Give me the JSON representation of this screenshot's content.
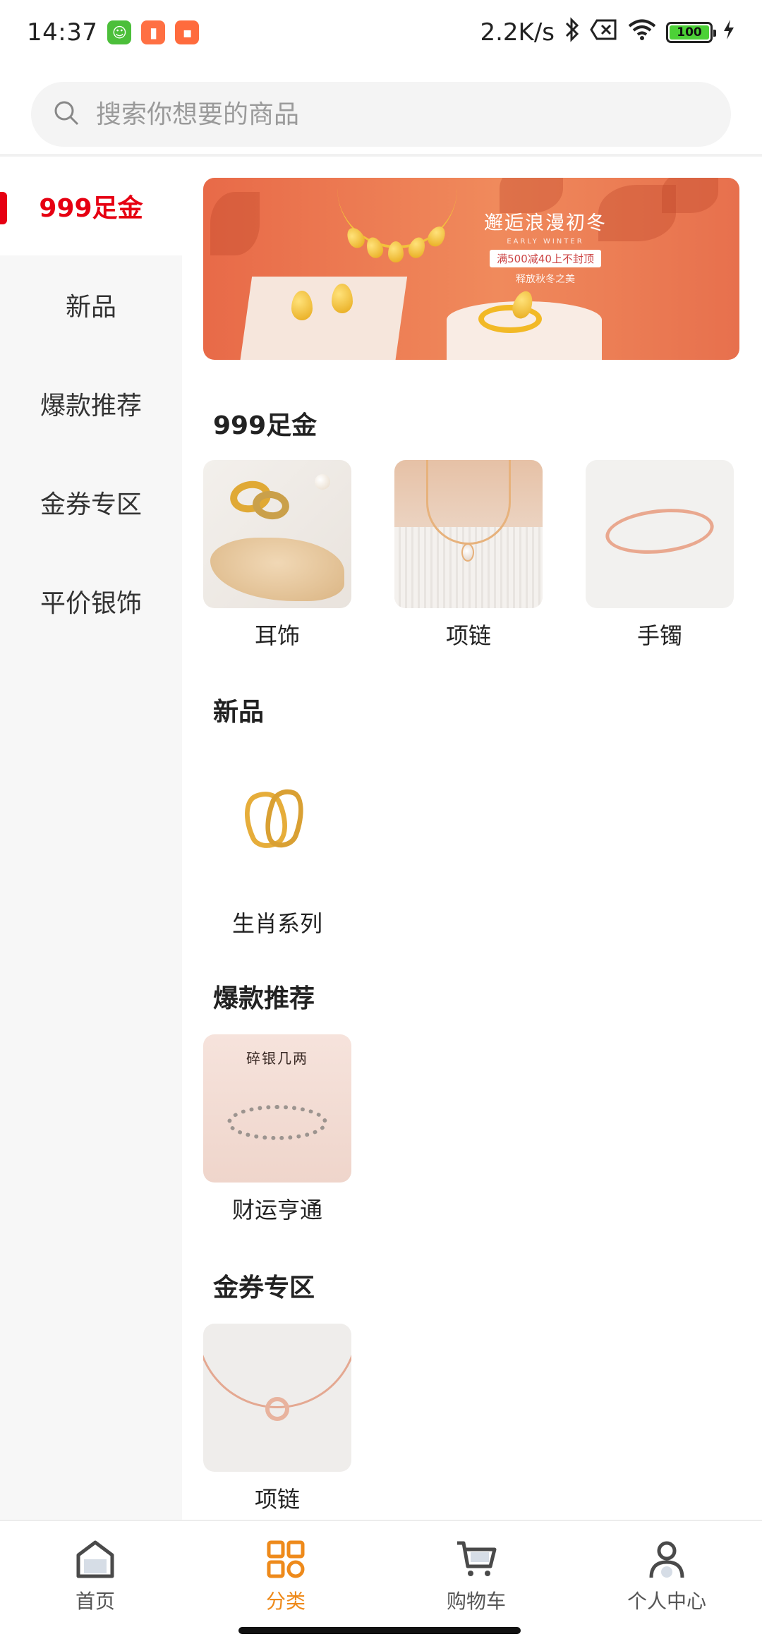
{
  "status_bar": {
    "time": "14:37",
    "net_speed": "2.2K/s",
    "battery": "100"
  },
  "search": {
    "placeholder": "搜索你想要的商品"
  },
  "sidebar": {
    "items": [
      {
        "label": "999足金",
        "active": true
      },
      {
        "label": "新品",
        "active": false
      },
      {
        "label": "爆款推荐",
        "active": false
      },
      {
        "label": "金券专区",
        "active": false
      },
      {
        "label": "平价银饰",
        "active": false
      }
    ]
  },
  "banner": {
    "title": "邂逅浪漫初冬",
    "subtitle": "EARLY WINTER",
    "promo": "满500减40上不封顶",
    "tag": "释放秋冬之美"
  },
  "sections": [
    {
      "title": "999足金",
      "products": [
        {
          "label": "耳饰",
          "icon": "gold-rings-image"
        },
        {
          "label": "项链",
          "icon": "pendant-necklace-image"
        },
        {
          "label": "手镯",
          "icon": "rose-gold-bangle-image"
        }
      ]
    },
    {
      "title": "新品",
      "products": [
        {
          "label": "生肖系列",
          "icon": "gold-twist-ring-image"
        }
      ]
    },
    {
      "title": "爆款推荐",
      "products": [
        {
          "label": "财运亨通",
          "icon": "silver-bracelet-image"
        }
      ]
    },
    {
      "title": "金券专区",
      "products": [
        {
          "label": "项链",
          "icon": "rose-gold-circle-necklace-image"
        }
      ]
    }
  ],
  "product_image_text": {
    "silver_bracelet_caption": "碎银几两"
  },
  "bottom_nav": {
    "items": [
      {
        "label": "首页",
        "icon": "home-icon",
        "active": false
      },
      {
        "label": "分类",
        "icon": "category-grid-icon",
        "active": true
      },
      {
        "label": "购物车",
        "icon": "cart-icon",
        "active": false
      },
      {
        "label": "个人中心",
        "icon": "user-icon",
        "active": false
      }
    ]
  },
  "colors": {
    "accent_red": "#e60012",
    "nav_active": "#ee8a1b"
  }
}
